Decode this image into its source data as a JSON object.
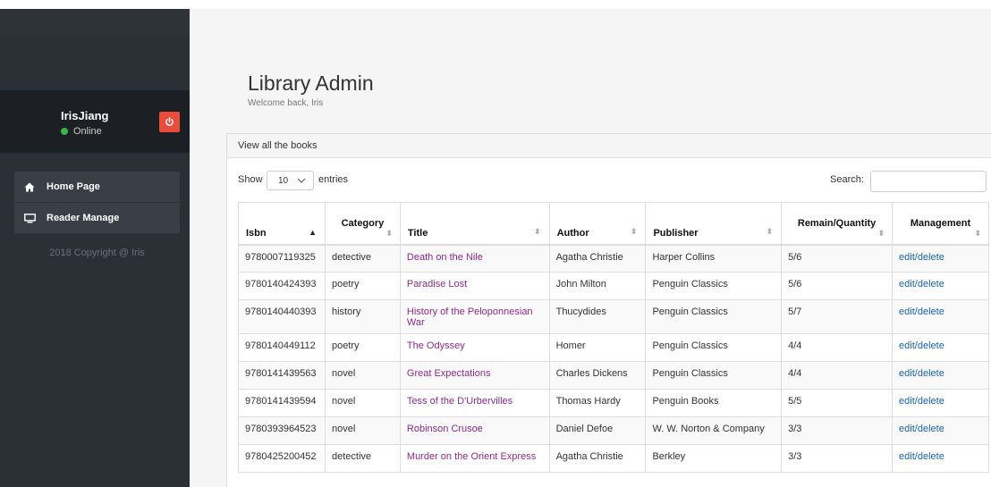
{
  "user": {
    "name": "IrisJiang",
    "status": "Online"
  },
  "sidebar": {
    "items": [
      {
        "label": "Home Page",
        "icon": "home-icon"
      },
      {
        "label": "Reader Manage",
        "icon": "monitor-icon"
      }
    ],
    "copyright": "2018 Copyright @ Iris"
  },
  "header": {
    "title": "Library Admin",
    "subtitle": "Welcome back, Iris"
  },
  "panel": {
    "heading": "View all the books"
  },
  "table_controls": {
    "show_label": "Show",
    "page_size": "10",
    "entries_label": "entries",
    "search_label": "Search:"
  },
  "table": {
    "columns": [
      "Isbn",
      "Category",
      "Title",
      "Author",
      "Publisher",
      "Remain/Quantity",
      "Management"
    ],
    "rows": [
      {
        "isbn": "9780007119325",
        "category": "detective",
        "title": "Death on the Nile",
        "author": "Agatha Christie",
        "publisher": "Harper Collins",
        "rq": "5/6",
        "edit": "edit",
        "delete": "delete"
      },
      {
        "isbn": "9780140424393",
        "category": "poetry",
        "title": "Paradise Lost",
        "author": "John Milton",
        "publisher": "Penguin Classics",
        "rq": "5/6",
        "edit": "edit",
        "delete": "delete"
      },
      {
        "isbn": "9780140440393",
        "category": "history",
        "title": "History of the Peloponnesian War",
        "author": "Thucydides",
        "publisher": "Penguin Classics",
        "rq": "5/7",
        "edit": "edit",
        "delete": "delete"
      },
      {
        "isbn": "9780140449112",
        "category": "poetry",
        "title": "The Odyssey",
        "author": "Homer",
        "publisher": "Penguin Classics",
        "rq": "4/4",
        "edit": "edit",
        "delete": "delete"
      },
      {
        "isbn": "9780141439563",
        "category": "novel",
        "title": "Great Expectations",
        "author": "Charles Dickens",
        "publisher": "Penguin Classics",
        "rq": "4/4",
        "edit": "edit",
        "delete": "delete"
      },
      {
        "isbn": "9780141439594",
        "category": "novel",
        "title": "Tess of the D'Urbervilles",
        "author": "Thomas Hardy",
        "publisher": "Penguin Books",
        "rq": "5/5",
        "edit": "edit",
        "delete": "delete"
      },
      {
        "isbn": "9780393964523",
        "category": "novel",
        "title": "Robinson Crusoe",
        "author": "Daniel Defoe",
        "publisher": "W. W. Norton & Company",
        "rq": "3/3",
        "edit": "edit",
        "delete": "delete"
      },
      {
        "isbn": "9780425200452",
        "category": "detective",
        "title": "Murder on the Orient Express",
        "author": "Agatha Christie",
        "publisher": "Berkley",
        "rq": "3/3",
        "edit": "edit",
        "delete": "delete"
      }
    ]
  },
  "colors": {
    "sidebar_bg": "#2b2f36",
    "logout_red": "#e74c3c",
    "status_green": "#3bb54a",
    "title_link": "#8e2b8e",
    "mgmt_link": "#1a63b0"
  }
}
